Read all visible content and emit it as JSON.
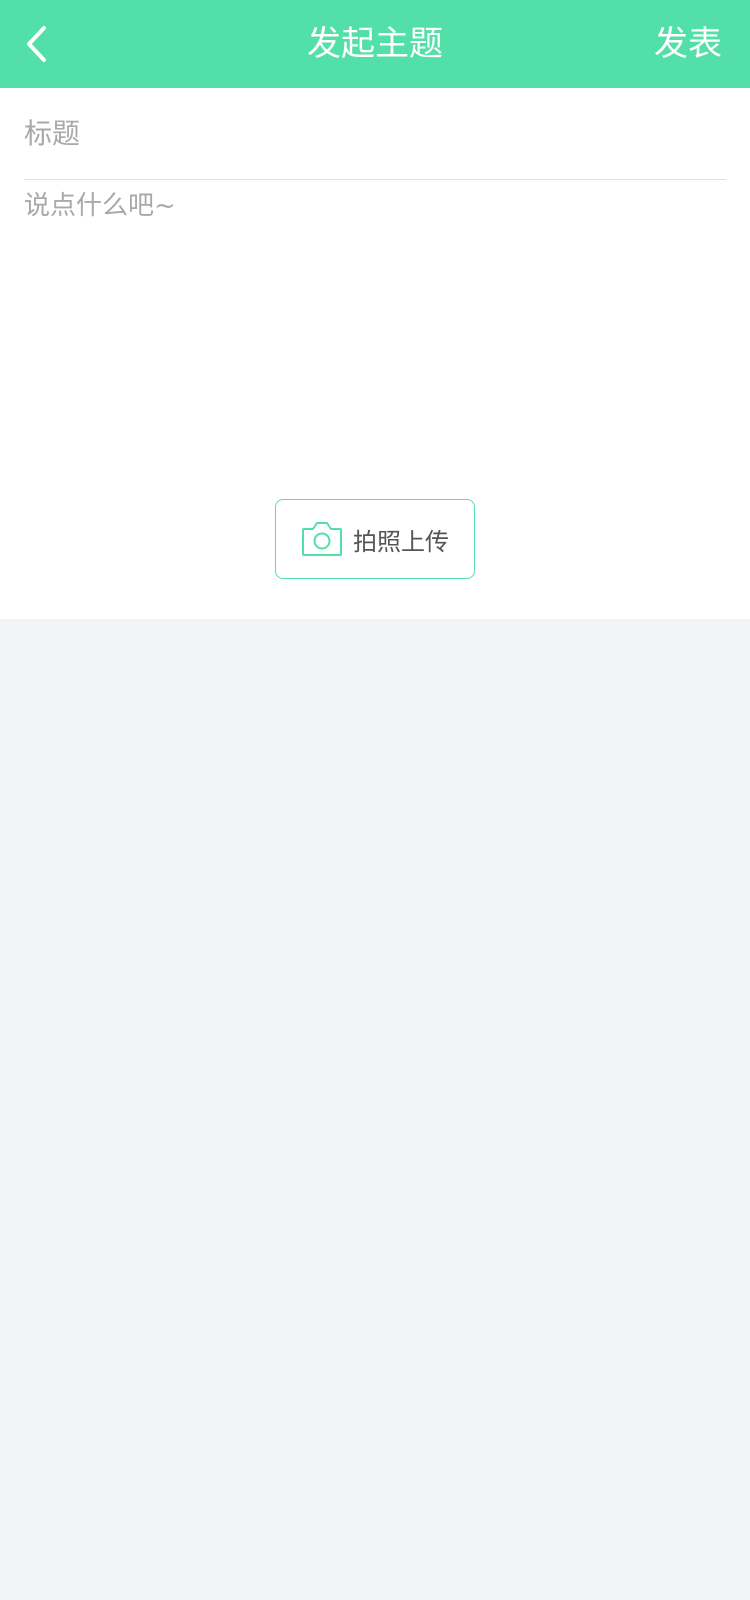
{
  "header": {
    "title": "发起主题",
    "publish_label": "发表",
    "back_icon": "chevron-left-icon"
  },
  "form": {
    "title_placeholder": "标题",
    "content_placeholder": "说点什么吧~",
    "upload_label": "拍照上传",
    "upload_icon": "camera-icon"
  },
  "colors": {
    "accent": "#53e0a8",
    "page_background": "#f1f4f7",
    "placeholder": "#a9a9a9"
  }
}
